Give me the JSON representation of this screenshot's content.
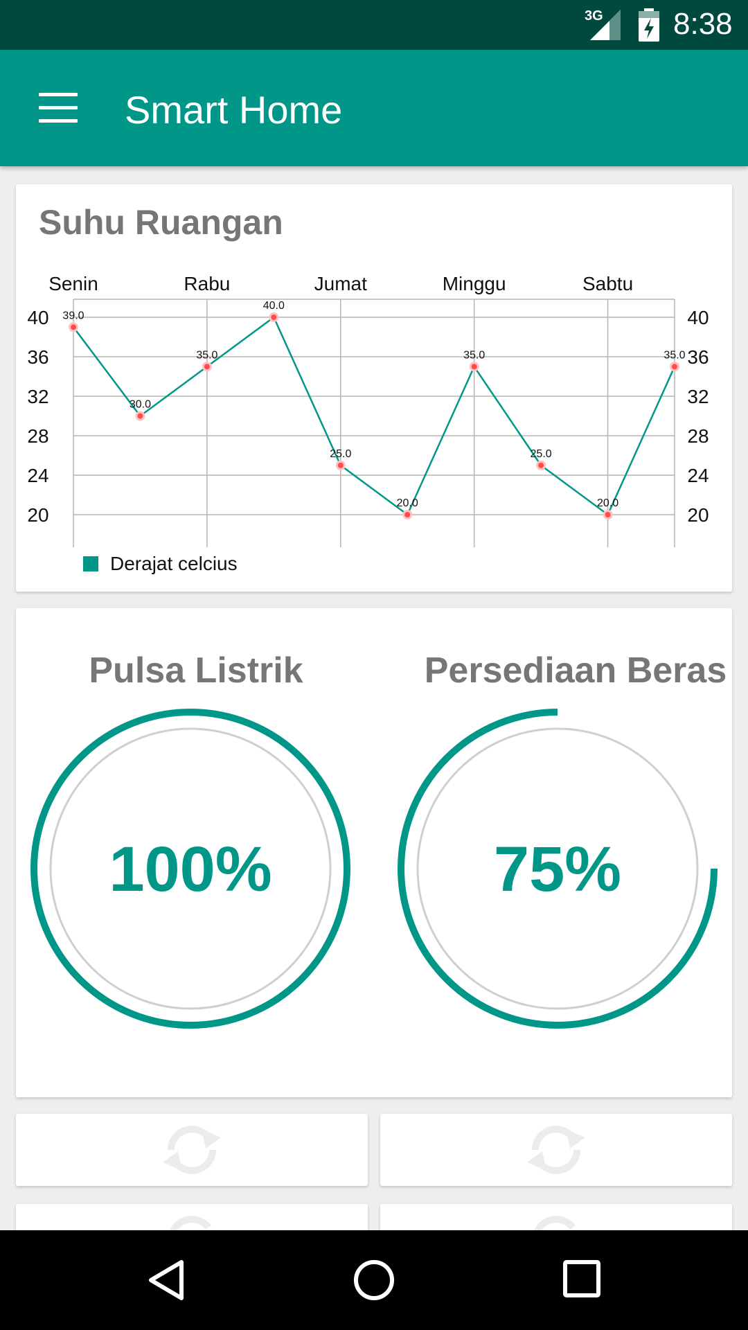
{
  "status_bar": {
    "network": "3G",
    "time": "8:38",
    "icons": [
      "signal-icon",
      "battery-charging-icon"
    ]
  },
  "app_bar": {
    "title": "Smart Home",
    "menu_icon": "hamburger-menu-icon"
  },
  "temperature_card": {
    "title": "Suhu Ruangan",
    "chart_data": {
      "type": "line",
      "title": "Suhu Ruangan",
      "x_axis_position": "top",
      "x_tick_labels": [
        "Senin",
        "Rabu",
        "Jumat",
        "Minggu",
        "Sabtu"
      ],
      "series": [
        {
          "name": "Derajat celcius",
          "color": "#009788",
          "point_color": "#ff4d4d",
          "values": [
            39.0,
            30.0,
            35.0,
            40.0,
            25.0,
            20.0,
            35.0,
            25.0,
            20.0,
            35.0
          ],
          "value_labels": [
            "39.0",
            "30.0",
            "35.0",
            "40.0",
            "25.0",
            "20.0",
            "35.0",
            "25.0",
            "20.0",
            "35.0"
          ]
        }
      ],
      "y_ticks": [
        "40",
        "36",
        "32",
        "28",
        "24",
        "20"
      ],
      "ylim": [
        20,
        40
      ],
      "y_axis": "both sides",
      "grid": true,
      "legend": "bottom-left"
    }
  },
  "gauges": [
    {
      "title": "Pulsa Listrik",
      "value": 1.0,
      "label": "100%",
      "color": "#009788"
    },
    {
      "title": "Persediaan Beras",
      "value": 0.75,
      "label": "75%",
      "color": "#009788"
    }
  ],
  "action_cards": [
    {
      "icon": "refresh-icon"
    },
    {
      "icon": "refresh-icon"
    },
    {
      "icon": "refresh-icon"
    },
    {
      "icon": "refresh-icon"
    }
  ],
  "nav_bar": {
    "buttons": [
      "back-icon",
      "home-icon",
      "recents-icon"
    ]
  }
}
